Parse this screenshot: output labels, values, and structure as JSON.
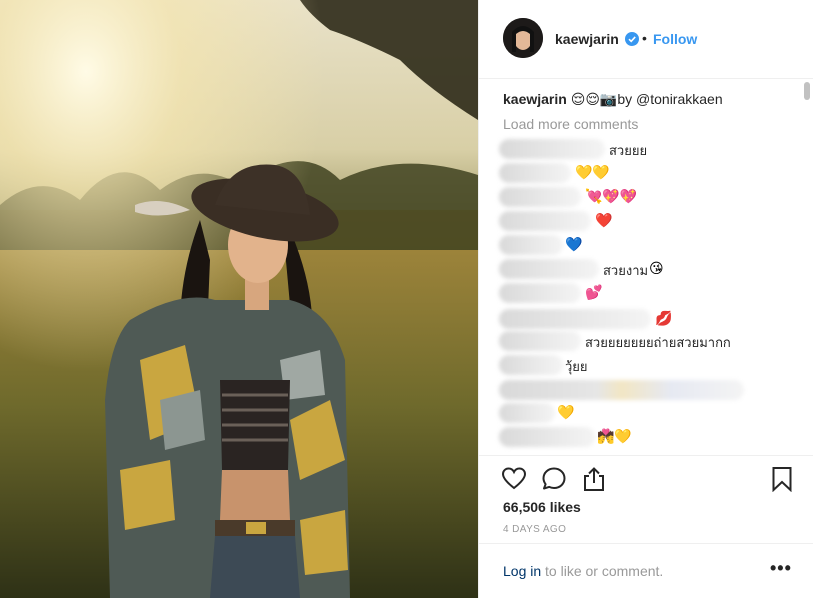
{
  "post": {
    "username": "kaewjarin",
    "separator": "•",
    "follow_label": "Follow",
    "caption_user": "kaewjarin",
    "caption_emoji": "😌😌📷",
    "caption_text": "by @tonirakkaen",
    "load_more_label": "Load more comments",
    "likes": "66,506 likes",
    "date": "4 DAYS AGO",
    "login_link": "Log in",
    "login_rest": " to like or comment.",
    "more_label": "•••"
  },
  "comments": [
    {
      "text": "สวยยย",
      "emoji": ""
    },
    {
      "text": "",
      "emoji": "💛💛"
    },
    {
      "text": "",
      "emoji": "💘💖💖"
    },
    {
      "text": "",
      "emoji": "❤️"
    },
    {
      "text": "",
      "emoji": "💙"
    },
    {
      "text": "สวยงาม",
      "emoji": "😘"
    },
    {
      "text": "",
      "emoji": "💕"
    },
    {
      "text": "",
      "emoji": "💋"
    },
    {
      "text": "สวยยยยยยยถ่ายสวยมากก",
      "emoji": ""
    },
    {
      "text": "วุ้ยย",
      "emoji": ""
    },
    {
      "text": "",
      "emoji": ""
    },
    {
      "text": "",
      "emoji": "💛"
    },
    {
      "text": "",
      "emoji": "💏💛"
    }
  ],
  "icons": [
    "heart-icon",
    "comment-icon",
    "share-icon",
    "bookmark-icon",
    "verified-icon"
  ],
  "colors": {
    "accent": "#3897f0",
    "link": "#003569",
    "muted": "#999999",
    "text": "#262626"
  }
}
